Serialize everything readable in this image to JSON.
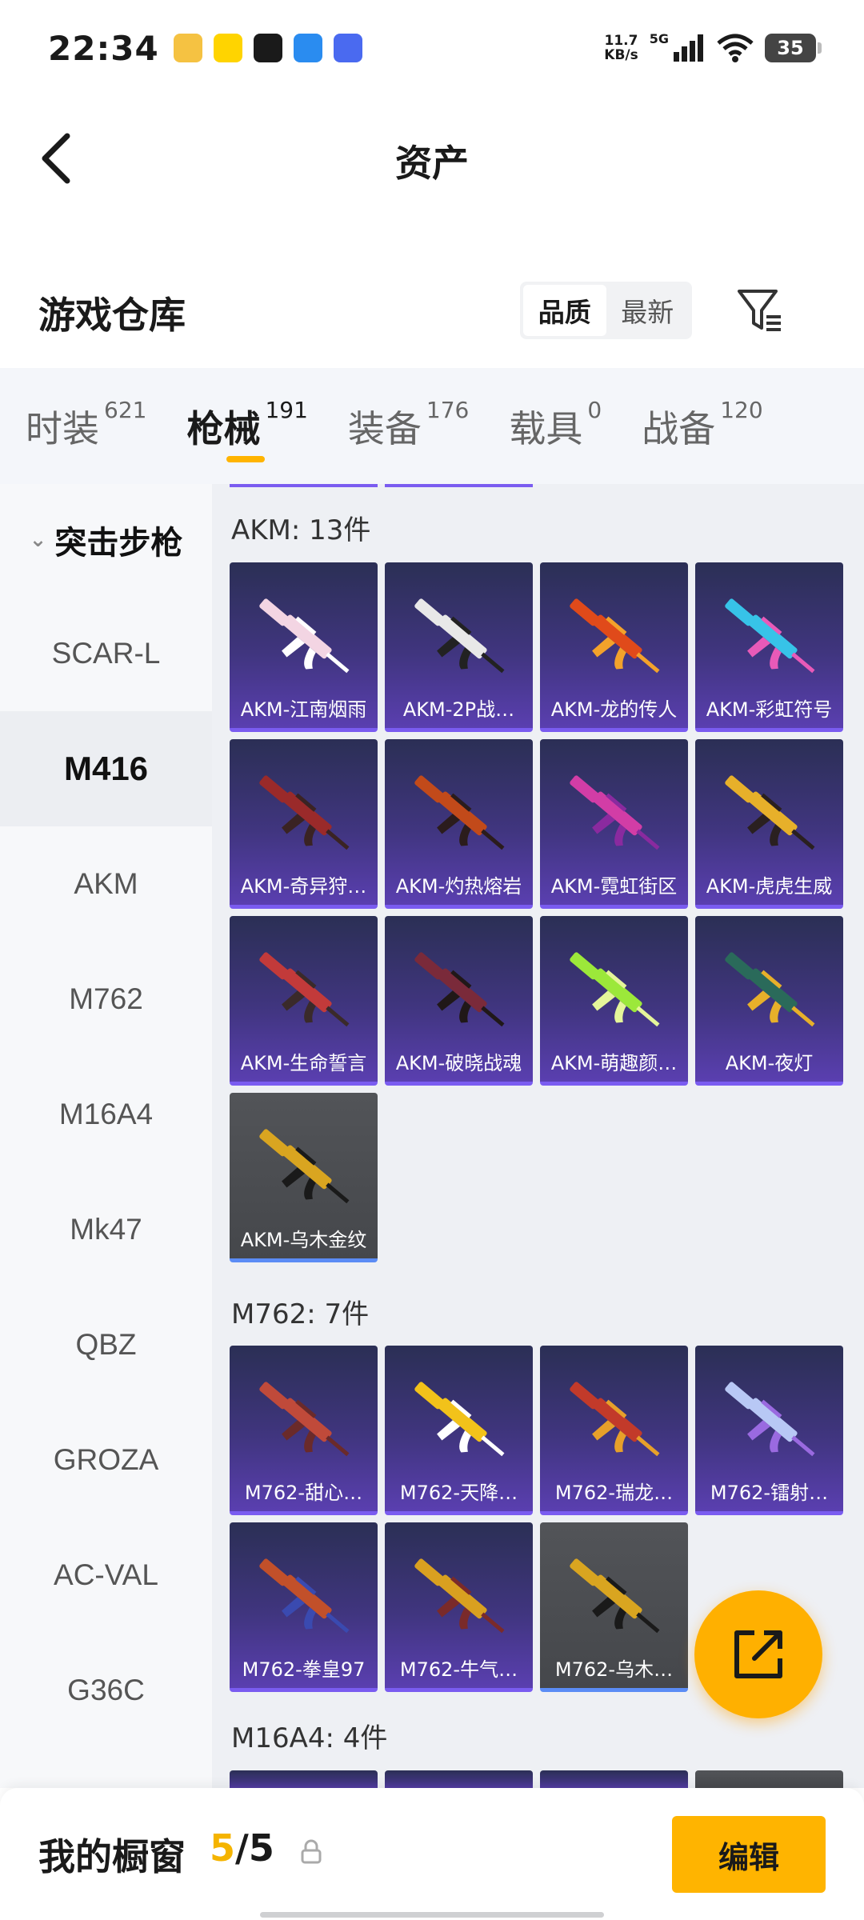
{
  "status_bar": {
    "time": "22:34",
    "net_speed_value": "11.7",
    "net_speed_unit": "KB/s",
    "signal_label": "5G",
    "battery": "35"
  },
  "header": {
    "title": "资产"
  },
  "warehouse": {
    "title": "游戏仓库",
    "sort_options": [
      "品质",
      "最新"
    ],
    "sort_selected": "品质"
  },
  "tabs": [
    {
      "label": "时装",
      "count": "621"
    },
    {
      "label": "枪械",
      "count": "191",
      "active": true
    },
    {
      "label": "装备",
      "count": "176"
    },
    {
      "label": "载具",
      "count": "0"
    },
    {
      "label": "战备",
      "count": "120"
    }
  ],
  "sidebar": {
    "heading": "突击步枪",
    "items": [
      "SCAR-L",
      "M416",
      "AKM",
      "M762",
      "M16A4",
      "Mk47",
      "QBZ",
      "GROZA",
      "AC-VAL",
      "G36C"
    ],
    "selected": "M416"
  },
  "sections": [
    {
      "title": "AKM: 13件",
      "items": [
        {
          "name": "AKM-江南烟雨",
          "tier": "purple",
          "colors": [
            "#f3d5e3",
            "#ffffff"
          ]
        },
        {
          "name": "AKM-2P战…",
          "tier": "purple",
          "colors": [
            "#e8e8e8",
            "#222222"
          ]
        },
        {
          "name": "AKM-龙的传人",
          "tier": "purple",
          "colors": [
            "#e04a1a",
            "#f3a22b"
          ]
        },
        {
          "name": "AKM-彩虹符号",
          "tier": "purple",
          "colors": [
            "#37c3e8",
            "#e85ab8"
          ]
        },
        {
          "name": "AKM-奇异狩…",
          "tier": "purple",
          "colors": [
            "#9a2a2a",
            "#3a2323"
          ]
        },
        {
          "name": "AKM-灼热熔岩",
          "tier": "purple",
          "colors": [
            "#c24a1a",
            "#2b1c1c"
          ]
        },
        {
          "name": "AKM-霓虹街区",
          "tier": "purple",
          "colors": [
            "#d23da6",
            "#8a2a9f"
          ]
        },
        {
          "name": "AKM-虎虎生威",
          "tier": "purple",
          "colors": [
            "#e7b02a",
            "#2a2020"
          ]
        },
        {
          "name": "AKM-生命誓言",
          "tier": "purple",
          "colors": [
            "#c23a3a",
            "#3a2a2a"
          ]
        },
        {
          "name": "AKM-破晓战魂",
          "tier": "purple",
          "colors": [
            "#7a2a3a",
            "#201818"
          ]
        },
        {
          "name": "AKM-萌趣颜…",
          "tier": "purple",
          "colors": [
            "#9ce83a",
            "#e5f59a"
          ]
        },
        {
          "name": "AKM-夜灯",
          "tier": "purple",
          "colors": [
            "#2a6a5a",
            "#e7b02a"
          ]
        },
        {
          "name": "AKM-乌木金纹",
          "tier": "gray",
          "colors": [
            "#d9a520",
            "#1a1a1a"
          ]
        }
      ]
    },
    {
      "title": "M762: 7件",
      "items": [
        {
          "name": "M762-甜心…",
          "tier": "purple",
          "colors": [
            "#c04a3a",
            "#6a2a2a"
          ]
        },
        {
          "name": "M762-天降…",
          "tier": "purple",
          "colors": [
            "#f2c21a",
            "#ffffff"
          ]
        },
        {
          "name": "M762-瑞龙…",
          "tier": "purple",
          "colors": [
            "#c23a2a",
            "#e7a02a"
          ]
        },
        {
          "name": "M762-镭射…",
          "tier": "purple",
          "colors": [
            "#b8c8f5",
            "#9a6ae0"
          ]
        },
        {
          "name": "M762-拳皇97",
          "tier": "purple",
          "colors": [
            "#c2502a",
            "#3a4ab0"
          ]
        },
        {
          "name": "M762-牛气…",
          "tier": "purple",
          "colors": [
            "#d9a020",
            "#7a2a2a"
          ]
        },
        {
          "name": "M762-乌木…",
          "tier": "gray",
          "colors": [
            "#d9a520",
            "#1a1a1a"
          ]
        }
      ]
    },
    {
      "title": "M16A4: 4件",
      "items": []
    }
  ],
  "bottom_bar": {
    "label": "我的橱窗",
    "current": "5",
    "separator": "/",
    "total": "5",
    "edit_label": "编辑"
  }
}
